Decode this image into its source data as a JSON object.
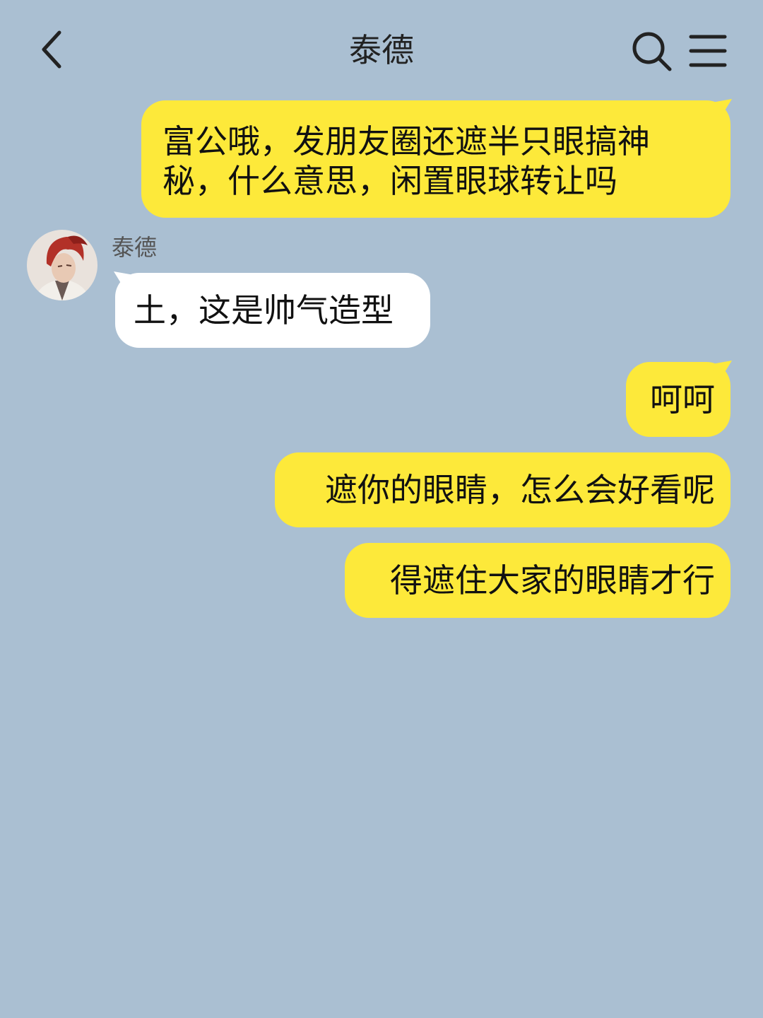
{
  "header": {
    "title": "泰德"
  },
  "icons": {
    "back": "chevron-left-icon",
    "search": "search-icon",
    "menu": "hamburger-menu-icon"
  },
  "colors": {
    "background": "#aabfd2",
    "outgoing_bubble": "#fde93a",
    "incoming_bubble": "#ffffff"
  },
  "contact": {
    "name": "泰德"
  },
  "messages": [
    {
      "direction": "out",
      "lines": [
        "富公哦，发朋友圈还遮半只眼搞神",
        "秘，什么意思，闲置眼球转让吗"
      ]
    },
    {
      "direction": "in",
      "text": "土，这是帅气造型"
    },
    {
      "direction": "out",
      "text": "呵呵"
    },
    {
      "direction": "out",
      "text": "遮你的眼睛，怎么会好看呢"
    },
    {
      "direction": "out",
      "text": "得遮住大家的眼睛才行"
    }
  ]
}
